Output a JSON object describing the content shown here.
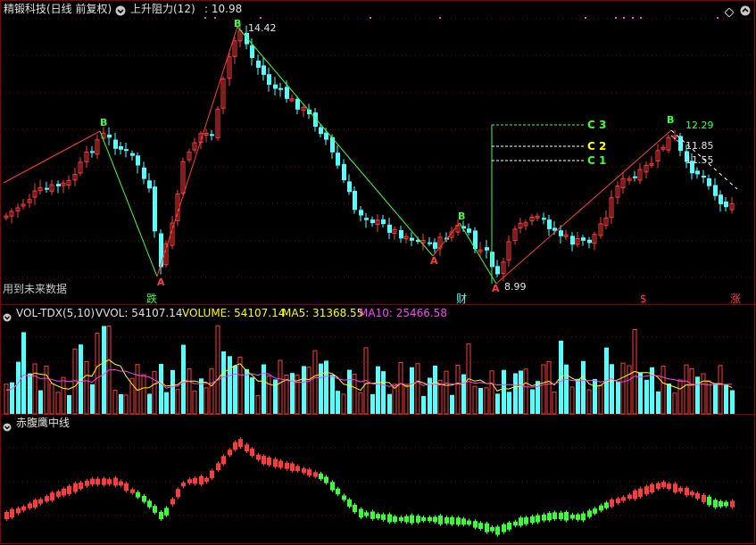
{
  "main_header": {
    "stock": "精锻科技(日线 前复权)",
    "indicator": "上升阻力(12)",
    "value": ": 10.98"
  },
  "price_labels": {
    "high": "14.42",
    "low": "8.99",
    "c1_value": "12.29",
    "c2_value": "11.85",
    "c3_value": "11.55",
    "c3_tag": "C 3",
    "c2_tag": "C 2",
    "c1_tag": "C 1",
    "b_tag": "B",
    "a_tag": "A"
  },
  "notice": "用到未来数据",
  "bottom_markers": {
    "m1": "跌",
    "m2": "财",
    "m3": "$",
    "m4": "涨"
  },
  "volume_header": {
    "name": "VOL-TDX(5,10)",
    "vvol": "VVOL: 54107.14",
    "volume": "VOLUME: 54107.14",
    "ma5": "MA5: 31368.55",
    "ma10": "MA10: 25466.58"
  },
  "lower_header": {
    "name": "赤腹鹰中线"
  },
  "colors": {
    "up": "#ff3c3c",
    "down": "#54ffff",
    "green": "#3cff3c",
    "yellow": "#ffff00",
    "magenta": "#ff40ff",
    "grid": "#8b0000"
  },
  "icons": [
    "chevron-down-icon",
    "diamond-icon",
    "chevron-up-icon"
  ],
  "chart_data": {
    "type": "candlestick",
    "price_range": [
      8.99,
      14.42
    ],
    "annotations": [
      "14.42",
      "8.99",
      "12.29",
      "11.85",
      "11.55"
    ]
  }
}
